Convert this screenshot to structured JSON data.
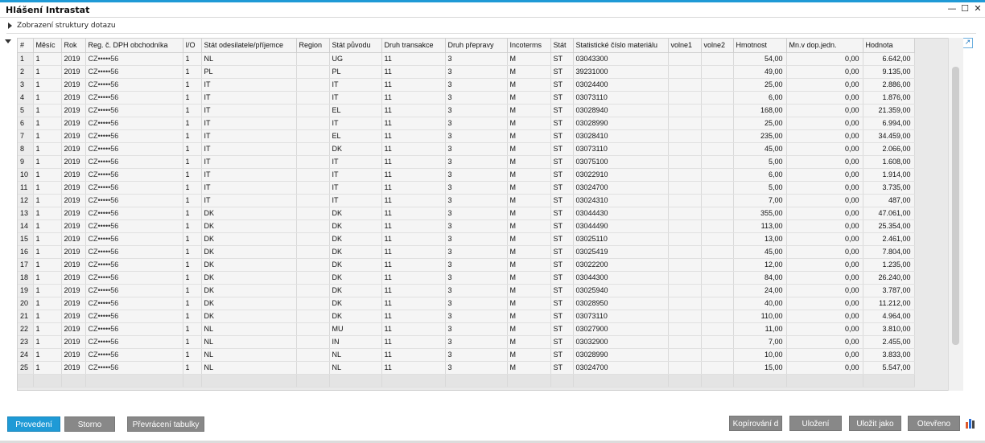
{
  "window": {
    "title": "Hlášení Intrastat",
    "minimize_glyph": "—",
    "maximize_glyph": "☐",
    "close_glyph": "✕"
  },
  "query_structure": {
    "label": "Zobrazení struktury dotazu"
  },
  "table": {
    "columns": [
      "#",
      "Měsíc",
      "Rok",
      "Reg. č. DPH obchodníka",
      "I/O",
      "Stát odesilatele/příjemce",
      "Region",
      "Stát původu",
      "Druh transakce",
      "Druh přepravy",
      "Incoterms",
      "Stát",
      "Statistické číslo materiálu",
      "volne1",
      "volne2",
      "Hmotnost",
      "Mn.v dop.jedn.",
      "Hodnota"
    ],
    "rows": [
      [
        "1",
        "1",
        "2019",
        "CZ•••••56",
        "1",
        "NL",
        "",
        "UG",
        "11",
        "3",
        "M",
        "ST",
        "03043300",
        "",
        "",
        "54,00",
        "0,00",
        "6.642,00"
      ],
      [
        "2",
        "1",
        "2019",
        "CZ•••••56",
        "1",
        "PL",
        "",
        "PL",
        "11",
        "3",
        "M",
        "ST",
        "39231000",
        "",
        "",
        "49,00",
        "0,00",
        "9.135,00"
      ],
      [
        "3",
        "1",
        "2019",
        "CZ•••••56",
        "1",
        "IT",
        "",
        "IT",
        "11",
        "3",
        "M",
        "ST",
        "03024400",
        "",
        "",
        "25,00",
        "0,00",
        "2.886,00"
      ],
      [
        "4",
        "1",
        "2019",
        "CZ•••••56",
        "1",
        "IT",
        "",
        "IT",
        "11",
        "3",
        "M",
        "ST",
        "03073110",
        "",
        "",
        "6,00",
        "0,00",
        "1.876,00"
      ],
      [
        "5",
        "1",
        "2019",
        "CZ•••••56",
        "1",
        "IT",
        "",
        "EL",
        "11",
        "3",
        "M",
        "ST",
        "03028940",
        "",
        "",
        "168,00",
        "0,00",
        "21.359,00"
      ],
      [
        "6",
        "1",
        "2019",
        "CZ•••••56",
        "1",
        "IT",
        "",
        "IT",
        "11",
        "3",
        "M",
        "ST",
        "03028990",
        "",
        "",
        "25,00",
        "0,00",
        "6.994,00"
      ],
      [
        "7",
        "1",
        "2019",
        "CZ•••••56",
        "1",
        "IT",
        "",
        "EL",
        "11",
        "3",
        "M",
        "ST",
        "03028410",
        "",
        "",
        "235,00",
        "0,00",
        "34.459,00"
      ],
      [
        "8",
        "1",
        "2019",
        "CZ•••••56",
        "1",
        "IT",
        "",
        "DK",
        "11",
        "3",
        "M",
        "ST",
        "03073110",
        "",
        "",
        "45,00",
        "0,00",
        "2.066,00"
      ],
      [
        "9",
        "1",
        "2019",
        "CZ•••••56",
        "1",
        "IT",
        "",
        "IT",
        "11",
        "3",
        "M",
        "ST",
        "03075100",
        "",
        "",
        "5,00",
        "0,00",
        "1.608,00"
      ],
      [
        "10",
        "1",
        "2019",
        "CZ•••••56",
        "1",
        "IT",
        "",
        "IT",
        "11",
        "3",
        "M",
        "ST",
        "03022910",
        "",
        "",
        "6,00",
        "0,00",
        "1.914,00"
      ],
      [
        "11",
        "1",
        "2019",
        "CZ•••••56",
        "1",
        "IT",
        "",
        "IT",
        "11",
        "3",
        "M",
        "ST",
        "03024700",
        "",
        "",
        "5,00",
        "0,00",
        "3.735,00"
      ],
      [
        "12",
        "1",
        "2019",
        "CZ•••••56",
        "1",
        "IT",
        "",
        "IT",
        "11",
        "3",
        "M",
        "ST",
        "03024310",
        "",
        "",
        "7,00",
        "0,00",
        "487,00"
      ],
      [
        "13",
        "1",
        "2019",
        "CZ•••••56",
        "1",
        "DK",
        "",
        "DK",
        "11",
        "3",
        "M",
        "ST",
        "03044430",
        "",
        "",
        "355,00",
        "0,00",
        "47.061,00"
      ],
      [
        "14",
        "1",
        "2019",
        "CZ•••••56",
        "1",
        "DK",
        "",
        "DK",
        "11",
        "3",
        "M",
        "ST",
        "03044490",
        "",
        "",
        "113,00",
        "0,00",
        "25.354,00"
      ],
      [
        "15",
        "1",
        "2019",
        "CZ•••••56",
        "1",
        "DK",
        "",
        "DK",
        "11",
        "3",
        "M",
        "ST",
        "03025110",
        "",
        "",
        "13,00",
        "0,00",
        "2.461,00"
      ],
      [
        "16",
        "1",
        "2019",
        "CZ•••••56",
        "1",
        "DK",
        "",
        "DK",
        "11",
        "3",
        "M",
        "ST",
        "03025419",
        "",
        "",
        "45,00",
        "0,00",
        "7.804,00"
      ],
      [
        "17",
        "1",
        "2019",
        "CZ•••••56",
        "1",
        "DK",
        "",
        "DK",
        "11",
        "3",
        "M",
        "ST",
        "03022200",
        "",
        "",
        "12,00",
        "0,00",
        "1.235,00"
      ],
      [
        "18",
        "1",
        "2019",
        "CZ•••••56",
        "1",
        "DK",
        "",
        "DK",
        "11",
        "3",
        "M",
        "ST",
        "03044300",
        "",
        "",
        "84,00",
        "0,00",
        "26.240,00"
      ],
      [
        "19",
        "1",
        "2019",
        "CZ•••••56",
        "1",
        "DK",
        "",
        "DK",
        "11",
        "3",
        "M",
        "ST",
        "03025940",
        "",
        "",
        "24,00",
        "0,00",
        "3.787,00"
      ],
      [
        "20",
        "1",
        "2019",
        "CZ•••••56",
        "1",
        "DK",
        "",
        "DK",
        "11",
        "3",
        "M",
        "ST",
        "03028950",
        "",
        "",
        "40,00",
        "0,00",
        "11.212,00"
      ],
      [
        "21",
        "1",
        "2019",
        "CZ•••••56",
        "1",
        "DK",
        "",
        "DK",
        "11",
        "3",
        "M",
        "ST",
        "03073110",
        "",
        "",
        "110,00",
        "0,00",
        "4.964,00"
      ],
      [
        "22",
        "1",
        "2019",
        "CZ•••••56",
        "1",
        "NL",
        "",
        "MU",
        "11",
        "3",
        "M",
        "ST",
        "03027900",
        "",
        "",
        "11,00",
        "0,00",
        "3.810,00"
      ],
      [
        "23",
        "1",
        "2019",
        "CZ•••••56",
        "1",
        "NL",
        "",
        "IN",
        "11",
        "3",
        "M",
        "ST",
        "03032900",
        "",
        "",
        "7,00",
        "0,00",
        "2.455,00"
      ],
      [
        "24",
        "1",
        "2019",
        "CZ•••••56",
        "1",
        "NL",
        "",
        "NL",
        "11",
        "3",
        "M",
        "ST",
        "03028990",
        "",
        "",
        "10,00",
        "0,00",
        "3.833,00"
      ],
      [
        "25",
        "1",
        "2019",
        "CZ•••••56",
        "1",
        "NL",
        "",
        "NL",
        "11",
        "3",
        "M",
        "ST",
        "03024700",
        "",
        "",
        "15,00",
        "0,00",
        "5.547,00"
      ]
    ]
  },
  "buttons": {
    "run": "Provedení",
    "cancel": "Storno",
    "pivot": "Převrácení tabulky",
    "copy": "Kopírování d",
    "save": "Uložení",
    "save_as": "Uložit jako",
    "open": "Otevřeno"
  },
  "colors": {
    "accent": "#1f9ad6",
    "dark_button": "#888888"
  }
}
